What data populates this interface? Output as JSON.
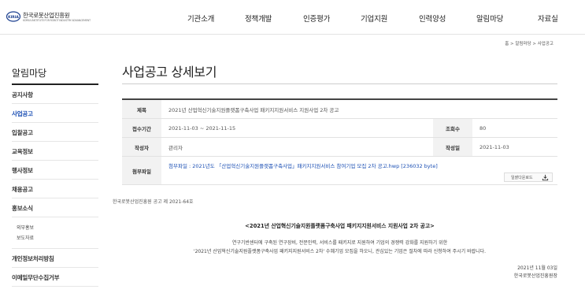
{
  "header": {
    "logo_text": "한국로봇산업진흥원",
    "logo_sub": "KOREA INSTITUTE FOR ROBOT INDUSTRY ADVANCEMENT",
    "logo_mark_text": "KIRIA",
    "nav": [
      "기관소개",
      "정책개발",
      "인증평가",
      "기업지원",
      "인력양성",
      "알림마당",
      "자료실"
    ]
  },
  "breadcrumb": "홈 > 알림마당 > 사업공고",
  "sidebar": {
    "title": "알림마당",
    "items": [
      {
        "label": "공지사항",
        "active": false
      },
      {
        "label": "사업공고",
        "active": true
      },
      {
        "label": "입찰공고",
        "active": false
      },
      {
        "label": "교육정보",
        "active": false
      },
      {
        "label": "행사정보",
        "active": false
      },
      {
        "label": "채용공고",
        "active": false
      },
      {
        "label": "홍보소식",
        "active": false
      }
    ],
    "subitems": [
      "외부홍보",
      "보도자료"
    ],
    "items_after": [
      {
        "label": "개인정보처리방침"
      },
      {
        "label": "이메일무단수집거부"
      }
    ]
  },
  "main": {
    "page_title": "사업공고 상세보기",
    "table": {
      "title_label": "제목",
      "title_value": "2021년 산업혁신기술지원플랫폼구축사업 패키지지원서비스 지원사업 2차 공고",
      "period_label": "접수기간",
      "period_value": "2021-11-03 ~ 2021-11-15",
      "views_label": "조회수",
      "views_value": "80",
      "author_label": "작성자",
      "author_value": "관리자",
      "date_label": "작성일",
      "date_value": "2021-11-03",
      "attach_label": "첨부파일",
      "attach_value": "첨부파일 : 2021년도 「산업혁신기술지원플랫폼구축사업」패키지지원서비스 참여기업 모집 2차 공고.hwp [236032 byte]",
      "download_label": "일괄다운로드"
    },
    "notice_no": "한국로봇산업진흥원 공고 제 2021-64호",
    "announce_title": "<2021년 산업혁신기술지원플랫폼구축사업 패키지지원서비스 지원사업 2차 공고>",
    "body_lines": [
      "연구기반센터에 구축된 연구장비, 전문인력, 서비스를 패키지로 지원하여 기업의 경쟁력 강화를 지원하기 위한",
      "'2021년 산업혁신기술지원플랫폼구축사업 패키지지원서비스 2차' 수혜기업 모집을 하오니, 관심있는 기업은 절차에 따라 신청하여 주시기 바랍니다."
    ],
    "sign_date": "2021년 11월 03일",
    "sign_org": "한국로봇산업진흥원장"
  },
  "colors": {
    "accent": "#1b4fb4",
    "rule": "#222222",
    "header_cell_bg": "#f2f2f2"
  }
}
